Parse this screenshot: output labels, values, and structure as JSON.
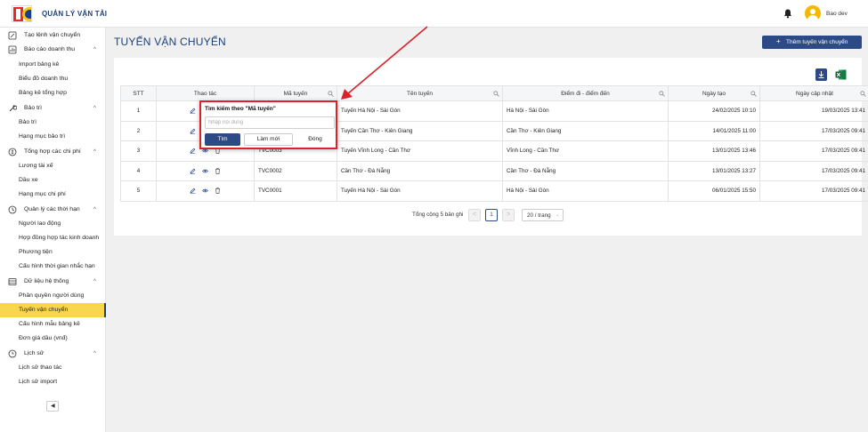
{
  "header": {
    "app_title": "QUẢN LÝ VẬN TẢI",
    "username": "Bao dev"
  },
  "sidebar": {
    "entries": [
      {
        "type": "group",
        "label": "Tạo lệnh vận chuyển",
        "icon": "file-edit-icon",
        "chevron": ""
      },
      {
        "type": "group",
        "label": "Báo cáo doanh thu",
        "icon": "report-icon",
        "chevron": "^"
      },
      {
        "type": "item",
        "label": "Import bảng kê"
      },
      {
        "type": "item",
        "label": "Biểu đồ doanh thu"
      },
      {
        "type": "item",
        "label": "Bảng kê tổng hợp"
      },
      {
        "type": "group",
        "label": "Bảo trì",
        "icon": "wrench-icon",
        "chevron": "^"
      },
      {
        "type": "item",
        "label": "Bảo trì"
      },
      {
        "type": "item",
        "label": "Hạng mục bảo trì"
      },
      {
        "type": "group",
        "label": "Tổng hợp các chi phí",
        "icon": "cost-icon",
        "chevron": "^"
      },
      {
        "type": "item",
        "label": "Lương tài xế"
      },
      {
        "type": "item",
        "label": "Dầu xe"
      },
      {
        "type": "item",
        "label": "Hạng mục chi phí"
      },
      {
        "type": "group",
        "label": "Quản lý các thời hạn",
        "icon": "clock-icon",
        "chevron": "^"
      },
      {
        "type": "item",
        "label": "Người lao động"
      },
      {
        "type": "item",
        "label": "Hợp đồng hợp tác kinh doanh"
      },
      {
        "type": "item",
        "label": "Phương tiện"
      },
      {
        "type": "item",
        "label": "Cấu hình thời gian nhắc hạn"
      },
      {
        "type": "group",
        "label": "Dữ liệu hệ thống",
        "icon": "database-icon",
        "chevron": "^"
      },
      {
        "type": "item",
        "label": "Phân quyền người dùng"
      },
      {
        "type": "item",
        "label": "Tuyến vận chuyển",
        "active": true
      },
      {
        "type": "item",
        "label": "Cấu hình mẫu bảng kê"
      },
      {
        "type": "item",
        "label": "Đơn giá dầu (vnđ)"
      },
      {
        "type": "group",
        "label": "Lịch sử",
        "icon": "history-icon",
        "chevron": "^"
      },
      {
        "type": "item",
        "label": "Lịch sử thao tác"
      },
      {
        "type": "item",
        "label": "Lịch sử import"
      }
    ]
  },
  "main": {
    "page_title": "TUYẾN VẬN CHUYỂN",
    "add_button": "Thêm tuyến vận chuyển",
    "table": {
      "headers": [
        "STT",
        "Thao tác",
        "Mã tuyến",
        "Tên tuyến",
        "Điểm đi - điểm đến",
        "Ngày tạo",
        "Ngày cập nhật"
      ],
      "rows": [
        [
          "1",
          "",
          "",
          "Tuyến Hà Nội - Sài Gòn",
          "Hà Nội - Sài Gòn",
          "24/02/2025 10:10",
          "19/03/2025 13:41"
        ],
        [
          "2",
          "",
          "",
          "Tuyến Cần Thơ - Kiên Giang",
          "Cần Thơ - Kiên Giang",
          "14/01/2025 11:00",
          "17/03/2025 09:41"
        ],
        [
          "3",
          "",
          "TVC0003",
          "Tuyến Vĩnh Long - Cần Thơ",
          "Vĩnh Long - Cần Thơ",
          "13/01/2025 13:46",
          "17/03/2025 09:41"
        ],
        [
          "4",
          "",
          "TVC0002",
          "Cần Thơ - Đà Nẵng",
          "Cần Thơ - Đà Nẵng",
          "13/01/2025 13:27",
          "17/03/2025 09:41"
        ],
        [
          "5",
          "",
          "TVC0001",
          "Tuyến Hà Nội - Sài Gòn",
          "Hà Nội - Sài Gòn",
          "06/01/2025 15:50",
          "17/03/2025 09:41"
        ]
      ]
    },
    "pagination": {
      "total_text": "Tổng cộng 5 bản ghi",
      "current_page": "1",
      "prev": "<",
      "next": ">",
      "per_page": "20 / trang"
    }
  },
  "popup": {
    "title": "Tìm kiếm theo \"Mã tuyến\"",
    "placeholder": "Nhập nội dung",
    "search_button": "Tìm",
    "reset_button": "Làm mới",
    "close_button": "Đóng"
  },
  "colors": {
    "primary": "#2b4a86",
    "active_menu": "#f8d74c",
    "highlight": "#d9222a",
    "excel": "#1d7a44"
  }
}
